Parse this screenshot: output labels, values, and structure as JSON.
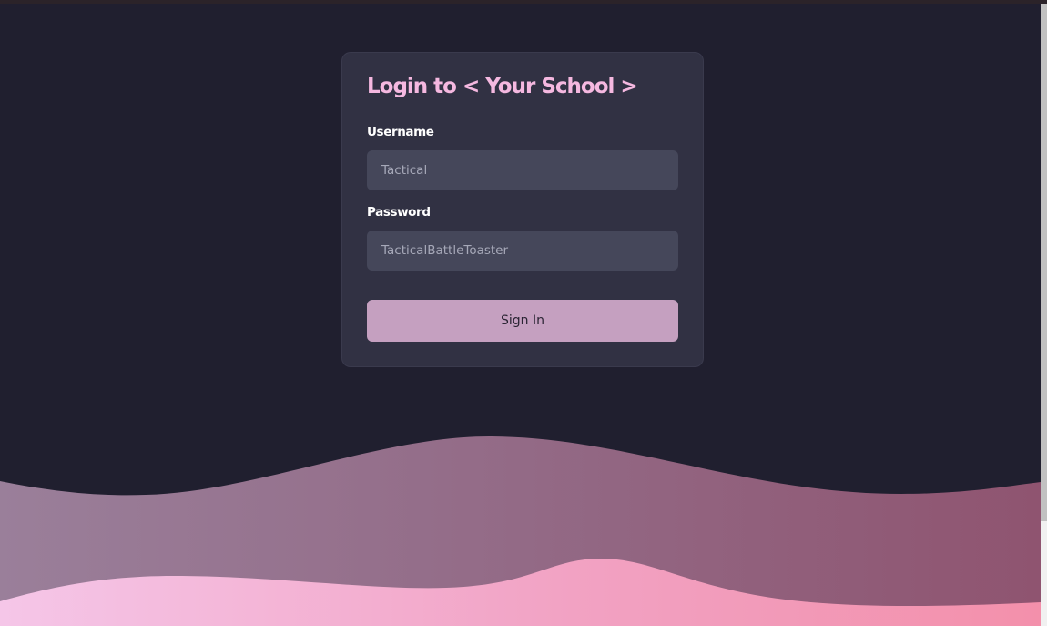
{
  "login": {
    "title": "Login to < Your School >",
    "username_label": "Username",
    "username_placeholder": "Tactical",
    "password_label": "Password",
    "password_placeholder": "TacticalBattleToaster",
    "signin_label": "Sign In"
  },
  "colors": {
    "background": "#201f2f",
    "card": "#313143",
    "title": "#f5b8e0",
    "input": "#45475a",
    "button": "#c5a0c0",
    "wave_back_start": "#9a7f9a",
    "wave_back_end": "#8f5470",
    "wave_front_start": "#f5c6e8",
    "wave_front_end": "#f390ab"
  }
}
